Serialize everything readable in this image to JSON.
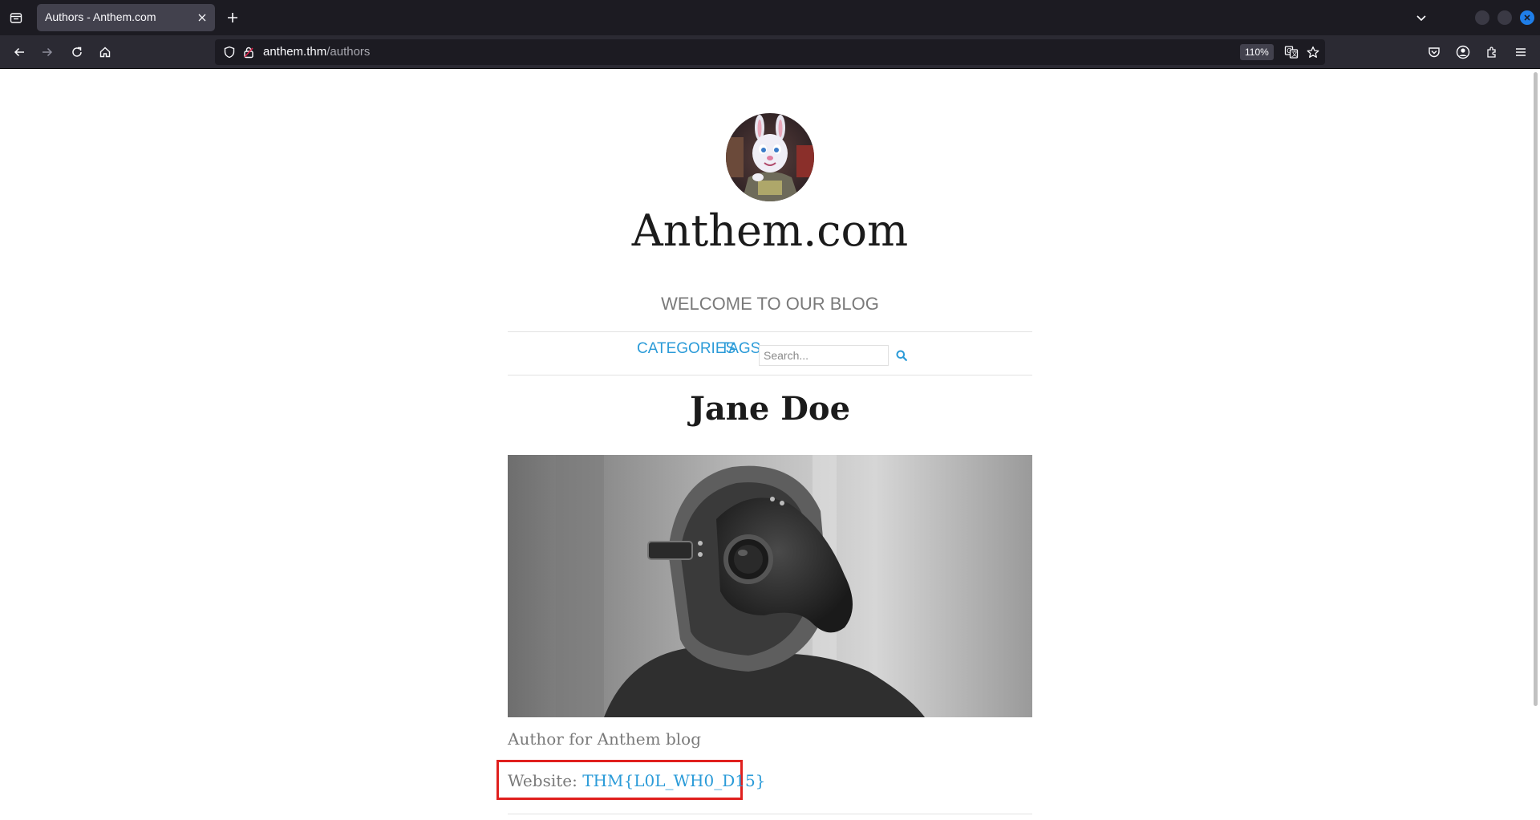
{
  "browser": {
    "tab": {
      "title": "Authors - Anthem.com"
    },
    "url": {
      "host": "anthem.thm",
      "path": "/authors"
    },
    "zoom": "110%",
    "icons": [
      "tab-list-icon",
      "close-icon",
      "plus-icon",
      "chevron-down-icon",
      "back-arrow-icon",
      "forward-arrow-icon",
      "reload-icon",
      "home-icon",
      "shield-icon",
      "lock-icon",
      "translate-icon",
      "star-icon",
      "pocket-icon",
      "account-icon",
      "extensions-icon",
      "menu-icon"
    ]
  },
  "site": {
    "title": "Anthem.com",
    "tagline": "WELCOME TO OUR BLOG",
    "menu": {
      "categories": "CATEGORIES",
      "tags": "TAGS"
    },
    "search": {
      "placeholder": "Search..."
    }
  },
  "author": {
    "name": "Jane Doe",
    "bio": "Author for Anthem blog",
    "website_label": "Website:",
    "website_value": "THM{L0L_WH0_D15}"
  },
  "colors": {
    "link": "#2b9bd8",
    "highlight_box": "#e0201e",
    "chrome_dark": "#1c1b22",
    "toolbar": "#2b2a33"
  }
}
